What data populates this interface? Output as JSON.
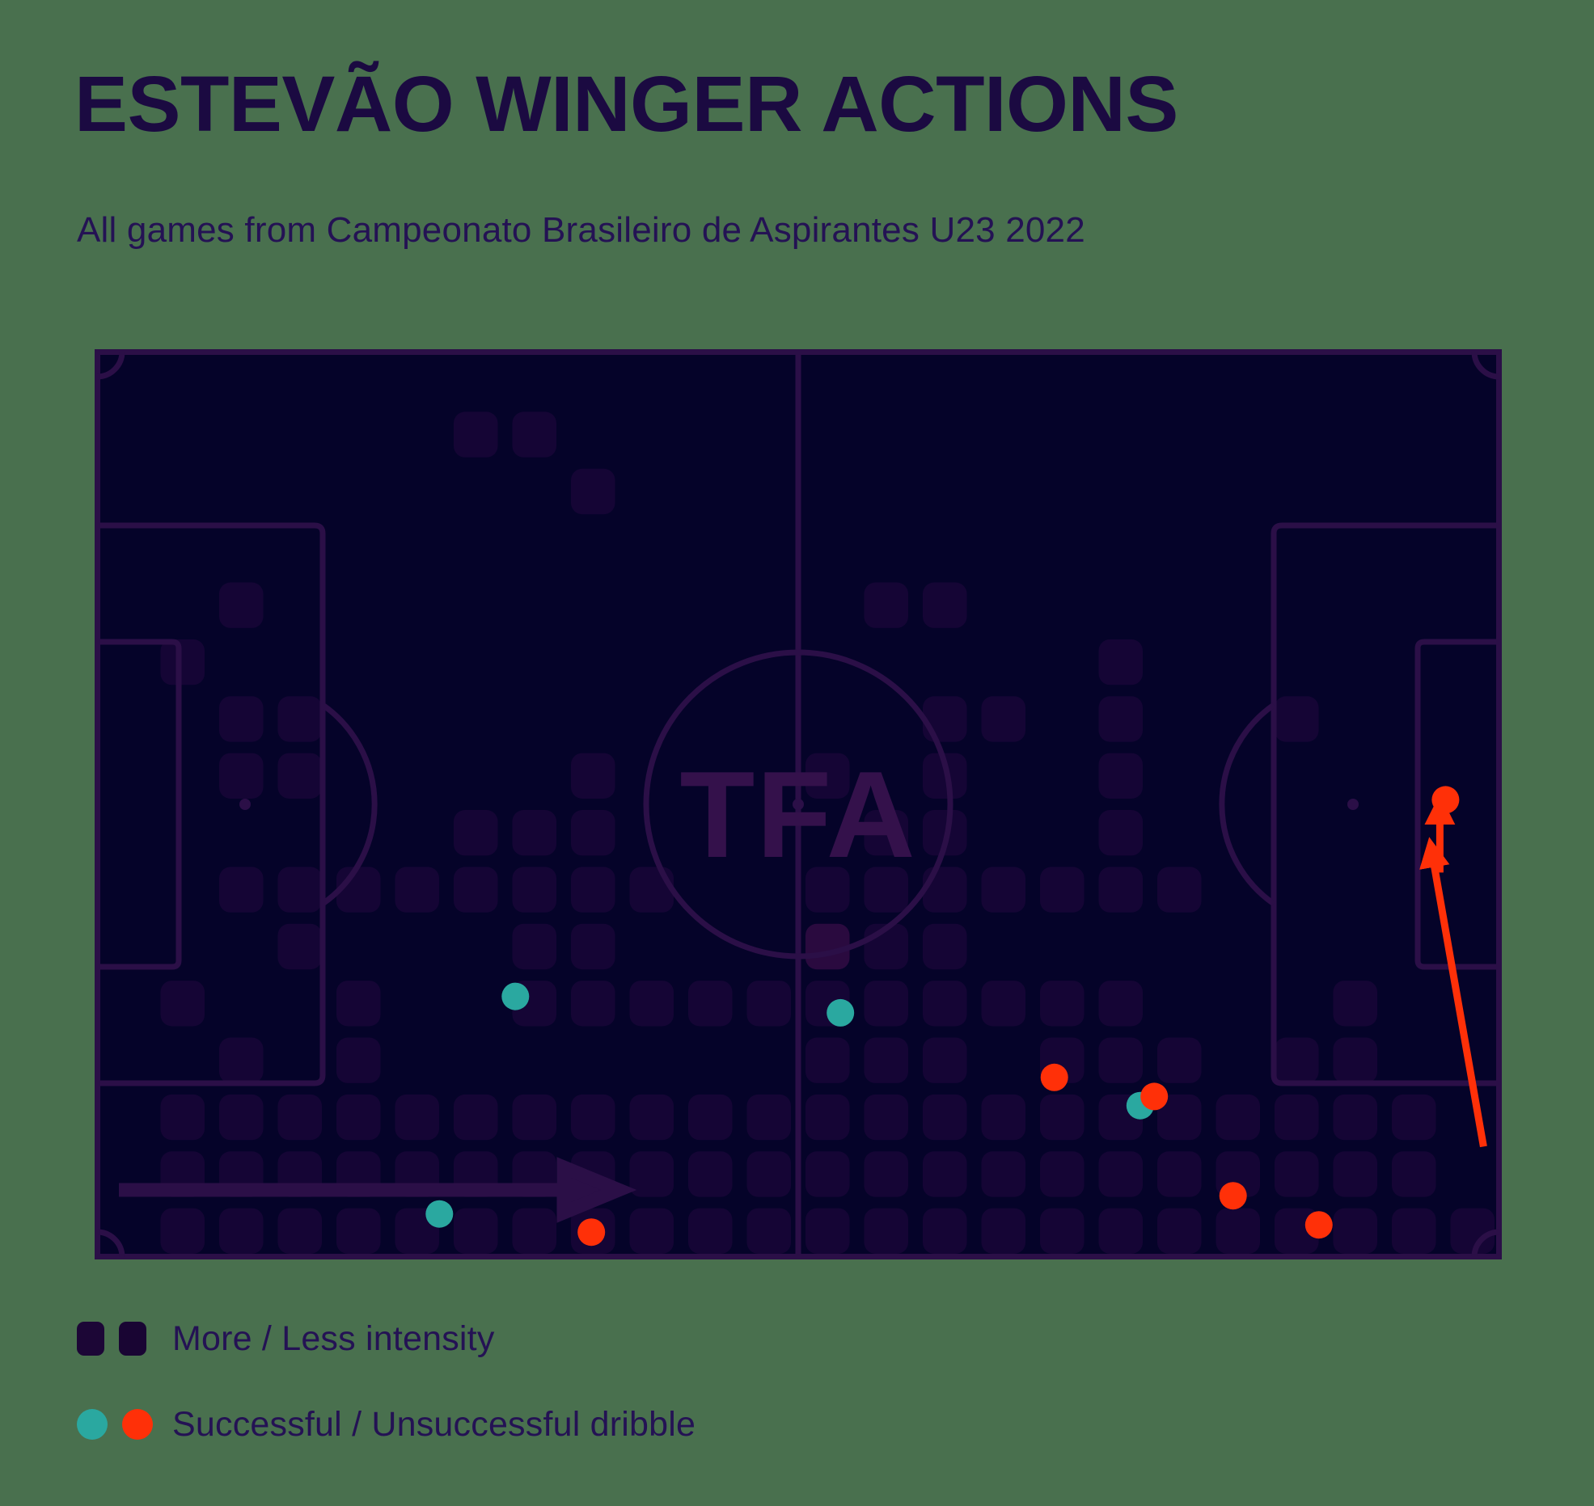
{
  "header": {
    "title": "ESTEVÃO WINGER ACTIONS",
    "subtitle": "All games from Campeonato Brasileiro de Aspirantes U23 2022"
  },
  "colors": {
    "page_background": "#49704e",
    "pitch_background": "#050329",
    "pitch_lines": "#2b0f47",
    "heat_low": "#150535",
    "heat_high": "#2a0a3f",
    "title_text": "#1b0a41",
    "subtitle_text": "#241254",
    "successful_dribble": "#2aa8a0",
    "unsuccessful_dribble": "#ff3008",
    "watermark": "#34114b"
  },
  "pitch": {
    "watermark_text": "TFA",
    "direction_arrow": "left-to-right"
  },
  "legend": {
    "rows": [
      {
        "id": "intensity",
        "label": "More / Less intensity",
        "swatch_type": "square",
        "swatches": [
          "#1c0636",
          "#190533"
        ]
      },
      {
        "id": "dribbles",
        "label": "Successful / Unsuccessful dribble",
        "swatch_type": "dot",
        "swatches": [
          "#2aa8a0",
          "#ff3008"
        ]
      }
    ]
  },
  "chart_data": {
    "type": "heatmap",
    "title": "ESTEVÃO WINGER ACTIONS",
    "subtitle": "All games from Campeonato Brasileiro de Aspirantes U23 2022",
    "xlabel": "",
    "ylabel": "",
    "grid": {
      "cols": 24,
      "rows": 16,
      "xlim": [
        0,
        100
      ],
      "ylim": [
        0,
        100
      ]
    },
    "legend_position": "below-left",
    "intensity_levels": [
      "low",
      "high"
    ],
    "cells": [
      {
        "col": 6,
        "row": 1,
        "v": 1
      },
      {
        "col": 7,
        "row": 1,
        "v": 1
      },
      {
        "col": 8,
        "row": 2,
        "v": 1
      },
      {
        "col": 2,
        "row": 4,
        "v": 1
      },
      {
        "col": 13,
        "row": 4,
        "v": 1
      },
      {
        "col": 14,
        "row": 4,
        "v": 1
      },
      {
        "col": 1,
        "row": 5,
        "v": 1
      },
      {
        "col": 17,
        "row": 5,
        "v": 1
      },
      {
        "col": 2,
        "row": 6,
        "v": 1
      },
      {
        "col": 3,
        "row": 6,
        "v": 1
      },
      {
        "col": 14,
        "row": 6,
        "v": 1
      },
      {
        "col": 15,
        "row": 6,
        "v": 1
      },
      {
        "col": 17,
        "row": 6,
        "v": 1
      },
      {
        "col": 20,
        "row": 6,
        "v": 1
      },
      {
        "col": 8,
        "row": 7,
        "v": 1
      },
      {
        "col": 12,
        "row": 7,
        "v": 1
      },
      {
        "col": 14,
        "row": 7,
        "v": 1
      },
      {
        "col": 17,
        "row": 7,
        "v": 1
      },
      {
        "col": 2,
        "row": 7,
        "v": 1
      },
      {
        "col": 3,
        "row": 7,
        "v": 1
      },
      {
        "col": 6,
        "row": 8,
        "v": 1
      },
      {
        "col": 7,
        "row": 8,
        "v": 1
      },
      {
        "col": 8,
        "row": 8,
        "v": 1
      },
      {
        "col": 13,
        "row": 8,
        "v": 1
      },
      {
        "col": 14,
        "row": 8,
        "v": 1
      },
      {
        "col": 17,
        "row": 8,
        "v": 1
      },
      {
        "col": 2,
        "row": 9,
        "v": 1
      },
      {
        "col": 3,
        "row": 9,
        "v": 1
      },
      {
        "col": 4,
        "row": 9,
        "v": 1
      },
      {
        "col": 5,
        "row": 9,
        "v": 1
      },
      {
        "col": 6,
        "row": 9,
        "v": 1
      },
      {
        "col": 7,
        "row": 9,
        "v": 1
      },
      {
        "col": 8,
        "row": 9,
        "v": 1
      },
      {
        "col": 9,
        "row": 9,
        "v": 1
      },
      {
        "col": 12,
        "row": 9,
        "v": 1
      },
      {
        "col": 13,
        "row": 9,
        "v": 1
      },
      {
        "col": 14,
        "row": 9,
        "v": 1
      },
      {
        "col": 15,
        "row": 9,
        "v": 1
      },
      {
        "col": 16,
        "row": 9,
        "v": 1
      },
      {
        "col": 17,
        "row": 9,
        "v": 1
      },
      {
        "col": 18,
        "row": 9,
        "v": 1
      },
      {
        "col": 3,
        "row": 10,
        "v": 1
      },
      {
        "col": 7,
        "row": 10,
        "v": 1
      },
      {
        "col": 8,
        "row": 10,
        "v": 1
      },
      {
        "col": 12,
        "row": 10,
        "v": 2
      },
      {
        "col": 13,
        "row": 10,
        "v": 1
      },
      {
        "col": 14,
        "row": 10,
        "v": 1
      },
      {
        "col": 1,
        "row": 11,
        "v": 1
      },
      {
        "col": 4,
        "row": 11,
        "v": 1
      },
      {
        "col": 7,
        "row": 11,
        "v": 1
      },
      {
        "col": 8,
        "row": 11,
        "v": 1
      },
      {
        "col": 9,
        "row": 11,
        "v": 1
      },
      {
        "col": 10,
        "row": 11,
        "v": 1
      },
      {
        "col": 11,
        "row": 11,
        "v": 1
      },
      {
        "col": 12,
        "row": 11,
        "v": 1
      },
      {
        "col": 13,
        "row": 11,
        "v": 1
      },
      {
        "col": 14,
        "row": 11,
        "v": 1
      },
      {
        "col": 15,
        "row": 11,
        "v": 1
      },
      {
        "col": 16,
        "row": 11,
        "v": 1
      },
      {
        "col": 17,
        "row": 11,
        "v": 1
      },
      {
        "col": 21,
        "row": 11,
        "v": 1
      },
      {
        "col": 2,
        "row": 12,
        "v": 1
      },
      {
        "col": 4,
        "row": 12,
        "v": 1
      },
      {
        "col": 12,
        "row": 12,
        "v": 1
      },
      {
        "col": 13,
        "row": 12,
        "v": 1
      },
      {
        "col": 14,
        "row": 12,
        "v": 1
      },
      {
        "col": 16,
        "row": 12,
        "v": 1
      },
      {
        "col": 17,
        "row": 12,
        "v": 1
      },
      {
        "col": 18,
        "row": 12,
        "v": 1
      },
      {
        "col": 20,
        "row": 12,
        "v": 1
      },
      {
        "col": 21,
        "row": 12,
        "v": 1
      },
      {
        "col": 1,
        "row": 13,
        "v": 1
      },
      {
        "col": 2,
        "row": 13,
        "v": 1
      },
      {
        "col": 3,
        "row": 13,
        "v": 1
      },
      {
        "col": 4,
        "row": 13,
        "v": 1
      },
      {
        "col": 5,
        "row": 13,
        "v": 1
      },
      {
        "col": 6,
        "row": 13,
        "v": 1
      },
      {
        "col": 7,
        "row": 13,
        "v": 1
      },
      {
        "col": 8,
        "row": 13,
        "v": 1
      },
      {
        "col": 9,
        "row": 13,
        "v": 1
      },
      {
        "col": 10,
        "row": 13,
        "v": 1
      },
      {
        "col": 11,
        "row": 13,
        "v": 1
      },
      {
        "col": 12,
        "row": 13,
        "v": 1
      },
      {
        "col": 13,
        "row": 13,
        "v": 1
      },
      {
        "col": 14,
        "row": 13,
        "v": 1
      },
      {
        "col": 15,
        "row": 13,
        "v": 1
      },
      {
        "col": 16,
        "row": 13,
        "v": 1
      },
      {
        "col": 17,
        "row": 13,
        "v": 1
      },
      {
        "col": 18,
        "row": 13,
        "v": 1
      },
      {
        "col": 19,
        "row": 13,
        "v": 1
      },
      {
        "col": 20,
        "row": 13,
        "v": 1
      },
      {
        "col": 21,
        "row": 13,
        "v": 1
      },
      {
        "col": 22,
        "row": 13,
        "v": 1
      },
      {
        "col": 1,
        "row": 14,
        "v": 1
      },
      {
        "col": 2,
        "row": 14,
        "v": 1
      },
      {
        "col": 3,
        "row": 14,
        "v": 1
      },
      {
        "col": 4,
        "row": 14,
        "v": 1
      },
      {
        "col": 5,
        "row": 14,
        "v": 1
      },
      {
        "col": 6,
        "row": 14,
        "v": 1
      },
      {
        "col": 7,
        "row": 14,
        "v": 1
      },
      {
        "col": 8,
        "row": 14,
        "v": 1
      },
      {
        "col": 9,
        "row": 14,
        "v": 1
      },
      {
        "col": 10,
        "row": 14,
        "v": 1
      },
      {
        "col": 11,
        "row": 14,
        "v": 1
      },
      {
        "col": 12,
        "row": 14,
        "v": 1
      },
      {
        "col": 13,
        "row": 14,
        "v": 1
      },
      {
        "col": 14,
        "row": 14,
        "v": 1
      },
      {
        "col": 15,
        "row": 14,
        "v": 1
      },
      {
        "col": 16,
        "row": 14,
        "v": 1
      },
      {
        "col": 17,
        "row": 14,
        "v": 1
      },
      {
        "col": 18,
        "row": 14,
        "v": 1
      },
      {
        "col": 19,
        "row": 14,
        "v": 1
      },
      {
        "col": 20,
        "row": 14,
        "v": 1
      },
      {
        "col": 21,
        "row": 14,
        "v": 1
      },
      {
        "col": 22,
        "row": 14,
        "v": 1
      },
      {
        "col": 1,
        "row": 15,
        "v": 1
      },
      {
        "col": 2,
        "row": 15,
        "v": 1
      },
      {
        "col": 3,
        "row": 15,
        "v": 1
      },
      {
        "col": 4,
        "row": 15,
        "v": 1
      },
      {
        "col": 5,
        "row": 15,
        "v": 1
      },
      {
        "col": 6,
        "row": 15,
        "v": 1
      },
      {
        "col": 7,
        "row": 15,
        "v": 1
      },
      {
        "col": 8,
        "row": 15,
        "v": 1
      },
      {
        "col": 9,
        "row": 15,
        "v": 1
      },
      {
        "col": 10,
        "row": 15,
        "v": 1
      },
      {
        "col": 11,
        "row": 15,
        "v": 1
      },
      {
        "col": 12,
        "row": 15,
        "v": 1
      },
      {
        "col": 13,
        "row": 15,
        "v": 1
      },
      {
        "col": 14,
        "row": 15,
        "v": 1
      },
      {
        "col": 15,
        "row": 15,
        "v": 1
      },
      {
        "col": 16,
        "row": 15,
        "v": 1
      },
      {
        "col": 17,
        "row": 15,
        "v": 1
      },
      {
        "col": 18,
        "row": 15,
        "v": 1
      },
      {
        "col": 19,
        "row": 15,
        "v": 1
      },
      {
        "col": 20,
        "row": 15,
        "v": 1
      },
      {
        "col": 21,
        "row": 15,
        "v": 1
      },
      {
        "col": 22,
        "row": 15,
        "v": 1
      },
      {
        "col": 23,
        "row": 15,
        "v": 1
      }
    ],
    "dribbles": [
      {
        "x": 29.9,
        "y": 71.1,
        "outcome": "successful"
      },
      {
        "x": 53.0,
        "y": 72.9,
        "outcome": "successful"
      },
      {
        "x": 68.2,
        "y": 80.0,
        "outcome": "unsuccessful"
      },
      {
        "x": 74.3,
        "y": 83.1,
        "outcome": "successful"
      },
      {
        "x": 75.3,
        "y": 82.1,
        "outcome": "unsuccessful"
      },
      {
        "x": 80.9,
        "y": 93.0,
        "outcome": "unsuccessful"
      },
      {
        "x": 87.0,
        "y": 96.2,
        "outcome": "unsuccessful"
      },
      {
        "x": 24.5,
        "y": 95.0,
        "outcome": "successful"
      },
      {
        "x": 35.3,
        "y": 97.0,
        "outcome": "unsuccessful"
      },
      {
        "x": 96.0,
        "y": 49.5,
        "outcome": "unsuccessful"
      }
    ],
    "carries": [
      {
        "x1": 98.7,
        "y1": 87.6,
        "x2": 95.0,
        "y2": 55.0,
        "color": "#ff3008"
      },
      {
        "x1": 95.6,
        "y1": 57.5,
        "x2": 95.6,
        "y2": 50.3,
        "color": "#ff3008"
      }
    ]
  }
}
